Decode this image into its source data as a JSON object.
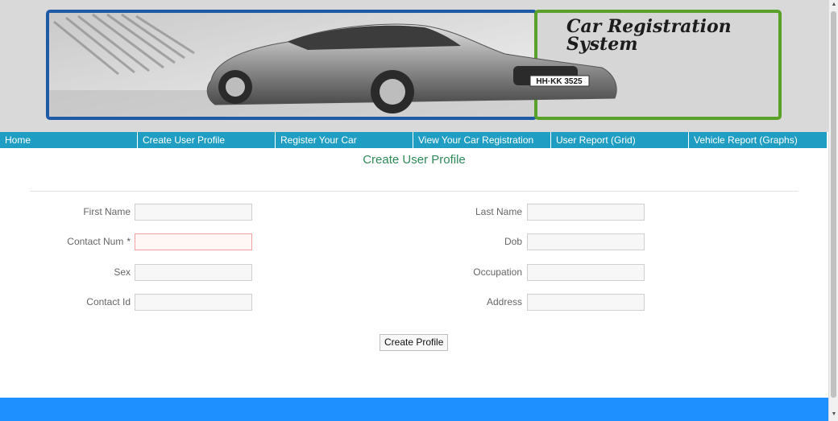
{
  "banner": {
    "title_line1": "Car Registration",
    "title_line2": "System",
    "plate_text": "HH·KK 3525"
  },
  "nav": {
    "items": [
      {
        "label": "Home"
      },
      {
        "label": "Create User Profile"
      },
      {
        "label": "Register Your Car"
      },
      {
        "label": "View Your Car Registration"
      },
      {
        "label": "User Report (Grid)"
      },
      {
        "label": "Vehicle Report (Graphs)"
      }
    ]
  },
  "form": {
    "title": "Create User Profile",
    "fields": {
      "first_name": {
        "label": "First Name",
        "value": ""
      },
      "contact_num": {
        "label": "Contact Num",
        "required_marker": "*",
        "value": ""
      },
      "sex": {
        "label": "Sex",
        "value": ""
      },
      "contact_id": {
        "label": "Contact Id",
        "value": ""
      },
      "last_name": {
        "label": "Last Name",
        "value": ""
      },
      "dob": {
        "label": "Dob",
        "value": ""
      },
      "occupation": {
        "label": "Occupation",
        "value": ""
      },
      "address": {
        "label": "Address",
        "value": ""
      }
    },
    "submit_label": "Create Profile"
  },
  "colors": {
    "nav_bg": "#1f9dc2",
    "title_color": "#2e8b57",
    "footer_bg": "#1e90ff",
    "banner_border_blue": "#1f5aa6",
    "banner_border_green": "#5aa12a"
  },
  "icons": {
    "scroll_up": "scroll-up-arrow-icon",
    "scroll_down": "scroll-down-arrow-icon"
  }
}
